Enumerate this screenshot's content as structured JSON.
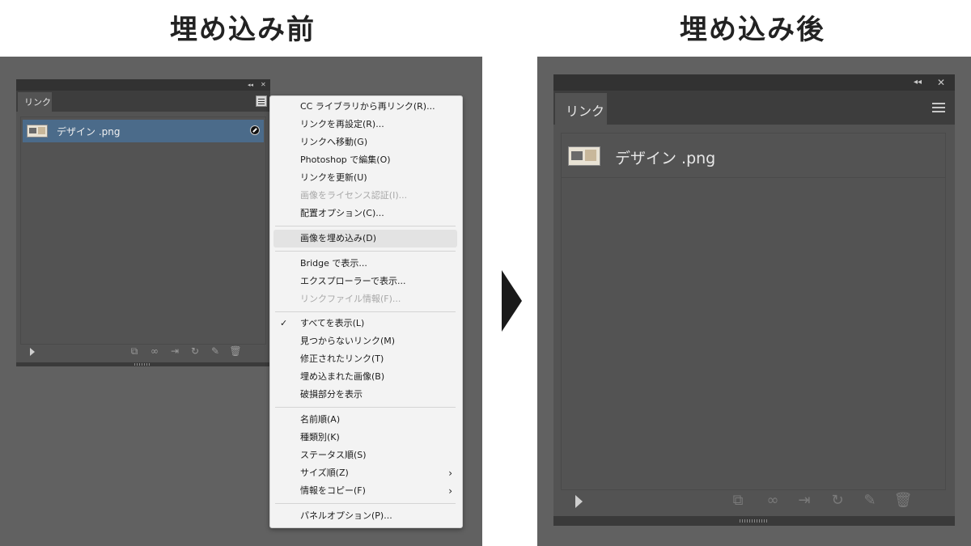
{
  "before": {
    "caption": "埋め込み前",
    "panel": {
      "tab_label": "リンク",
      "collapse_glyph": "◂◂",
      "close_glyph": "✕",
      "link_item": {
        "name": "デザイン .png",
        "status_icon": "link-badge-icon"
      },
      "footer_icons": [
        "relink-from-cc-icon",
        "relink-icon",
        "go-to-link-icon",
        "update-link-icon",
        "edit-original-icon",
        "delete-icon"
      ]
    },
    "menu": {
      "group1": [
        {
          "label": "CC ライブラリから再リンク(R)...",
          "disabled": false
        },
        {
          "label": "リンクを再設定(R)...",
          "disabled": false
        },
        {
          "label": "リンクへ移動(G)",
          "disabled": false
        },
        {
          "label": "Photoshop で編集(O)",
          "disabled": false
        },
        {
          "label": "リンクを更新(U)",
          "disabled": false
        },
        {
          "label": "画像をライセンス認証(I)...",
          "disabled": true
        },
        {
          "label": "配置オプション(C)...",
          "disabled": false
        }
      ],
      "group2": [
        {
          "label": "画像を埋め込み(D)",
          "disabled": false,
          "highlighted": true
        }
      ],
      "group3": [
        {
          "label": "Bridge で表示...",
          "disabled": false
        },
        {
          "label": "エクスプローラーで表示...",
          "disabled": false
        },
        {
          "label": "リンクファイル情報(F)...",
          "disabled": true
        }
      ],
      "group4": [
        {
          "label": "すべてを表示(L)",
          "checked": true
        },
        {
          "label": "見つからないリンク(M)"
        },
        {
          "label": "修正されたリンク(T)"
        },
        {
          "label": "埋め込まれた画像(B)"
        },
        {
          "label": "破損部分を表示"
        }
      ],
      "group5": [
        {
          "label": "名前順(A)"
        },
        {
          "label": "種類別(K)"
        },
        {
          "label": "ステータス順(S)"
        },
        {
          "label": "サイズ順(Z)",
          "submenu": true
        },
        {
          "label": "情報をコピー(F)",
          "submenu": true
        }
      ],
      "group6": [
        {
          "label": "パネルオプション(P)..."
        }
      ],
      "check_glyph": "✓",
      "submenu_glyph": "›"
    }
  },
  "arrow": "right-triangle",
  "after": {
    "caption": "埋め込み後",
    "panel": {
      "tab_label": "リンク",
      "collapse_glyph": "◂◂",
      "close_glyph": "✕",
      "link_item": {
        "name": "デザイン .png"
      },
      "footer_icons": [
        "relink-from-cc-icon",
        "relink-icon",
        "go-to-link-icon",
        "update-link-icon",
        "edit-original-icon",
        "delete-icon"
      ]
    }
  },
  "colors": {
    "canvas_bg": "#616161",
    "panel_bg": "#535353",
    "panel_header": "#323232",
    "selection": "#4b6b8a",
    "menu_bg": "#f3f3f3"
  }
}
